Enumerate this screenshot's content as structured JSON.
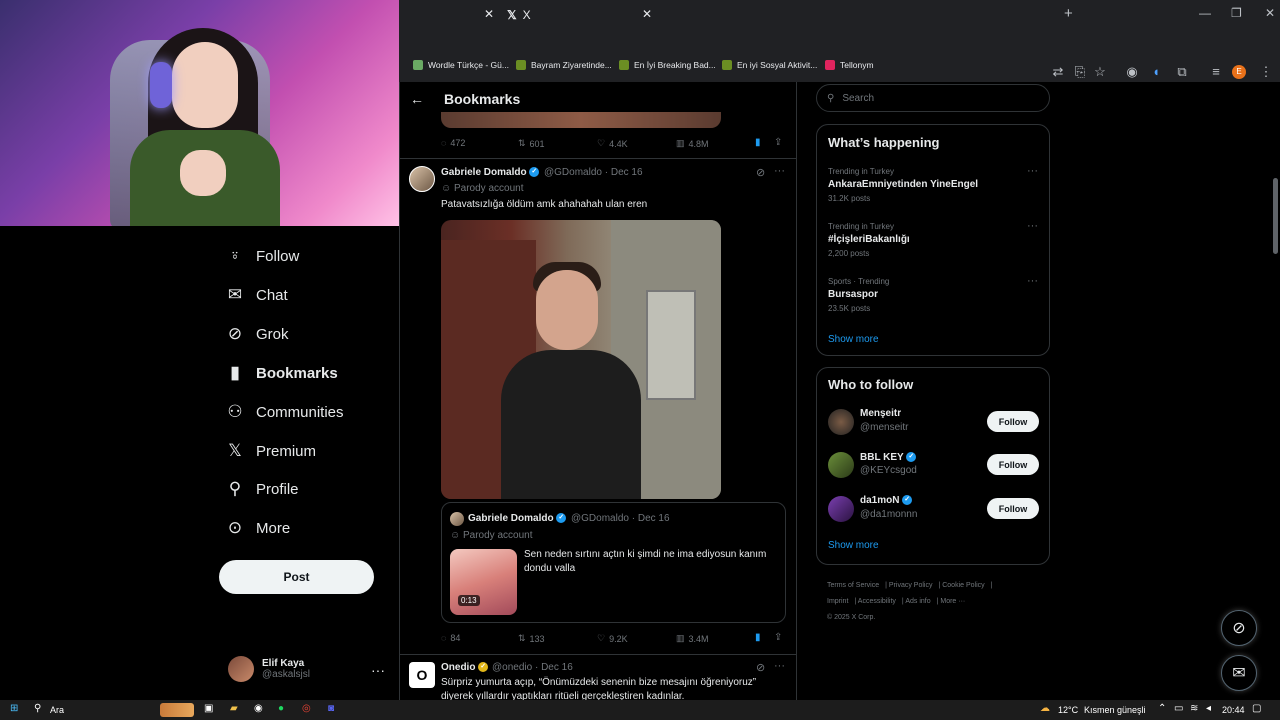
{
  "browser": {
    "tabs": [
      {
        "label": ""
      },
      {
        "label": "X"
      }
    ],
    "new_tab_icon": "+",
    "bookmarks": [
      {
        "label": "Wordle Türkçe - Gü...",
        "color": "#6aaa64"
      },
      {
        "label": "Bayram Ziyaretinde...",
        "color": "#6b8e23"
      },
      {
        "label": "En İyi Breaking Bad...",
        "color": "#6b8e23"
      },
      {
        "label": "En iyi Sosyal Aktivit...",
        "color": "#6b8e23"
      },
      {
        "label": "Tellonym",
        "color": "#e0245e"
      }
    ],
    "profile_initial": "E"
  },
  "left_nav": {
    "items": [
      {
        "label": "Follow",
        "icon": "person-add-icon"
      },
      {
        "label": "Chat",
        "icon": "mail-icon"
      },
      {
        "label": "Grok",
        "icon": "grok-icon"
      },
      {
        "label": "Bookmarks",
        "icon": "bookmark-icon",
        "active": true
      },
      {
        "label": "Communities",
        "icon": "people-icon"
      },
      {
        "label": "Premium",
        "icon": "x-logo-icon"
      },
      {
        "label": "Profile",
        "icon": "profile-icon"
      },
      {
        "label": "More",
        "icon": "more-circle-icon"
      }
    ],
    "post_label": "Post",
    "user": {
      "name": "Elif Kaya",
      "handle": "@askalsjsl"
    }
  },
  "timeline": {
    "title": "Bookmarks",
    "prev_actions": {
      "replies": "472",
      "reposts": "601",
      "likes": "4.4K",
      "views": "4.8M"
    },
    "tweet1": {
      "name": "Gabriele Domaldo",
      "handle": "@GDomaldo",
      "date": "· Dec 16",
      "parody": "Parody account",
      "text": "Patavatsızlığa öldüm amk ahahahah ulan eren",
      "quote": {
        "name": "Gabriele Domaldo",
        "handle": "@GDomaldo",
        "date": "· Dec 16",
        "parody": "Parody account",
        "text_line1": "Sen neden sırtını açtın ki şimdi ne ima ediyosun kanım",
        "text_line2": "dondu valla",
        "duration": "0:13"
      },
      "actions": {
        "replies": "84",
        "reposts": "133",
        "likes": "9.2K",
        "views": "3.4M"
      }
    },
    "tweet2": {
      "name": "Onedio",
      "handle": "@onedio",
      "date": "· Dec 16",
      "text_line1": "Sürpriz yumurta açıp, “Önümüzdeki senenin bize mesajını öğreniyoruz”",
      "text_line2": "diyerek yıllardır yaptıkları ritüeli gerçekleştiren kadınlar."
    }
  },
  "sidebar": {
    "search_placeholder": "Search",
    "happening": {
      "title": "What’s happening",
      "trends": [
        {
          "context": "Trending in Turkey",
          "name": "AnkaraEmniyetinden YineEngel",
          "count": "31.2K posts"
        },
        {
          "context": "Trending in Turkey",
          "name": "#İçişleriBakanlığı",
          "count": "2,200 posts"
        },
        {
          "context": "Sports · Trending",
          "name": "Bursaspor",
          "count": "23.5K posts"
        }
      ],
      "show_more": "Show more"
    },
    "who_to_follow": {
      "title": "Who to follow",
      "accounts": [
        {
          "name": "Menşeitr",
          "handle": "@menseitr",
          "verified": false
        },
        {
          "name": "BBL KEY",
          "handle": "@KEYcsgod",
          "verified": true
        },
        {
          "name": "da1moN",
          "handle": "@da1monnn",
          "verified": true
        }
      ],
      "follow_label": "Follow",
      "show_more": "Show more"
    },
    "footer": {
      "links": [
        "Terms of Service",
        "Privacy Policy",
        "Cookie Policy",
        "Imprint",
        "Accessibility",
        "Ads info",
        "More ···"
      ],
      "copyright": "© 2025 X Corp."
    }
  },
  "taskbar": {
    "search_label": "Ara",
    "weather": "12°C",
    "weather_desc": "Kısmen güneşli",
    "time": "20:44"
  }
}
